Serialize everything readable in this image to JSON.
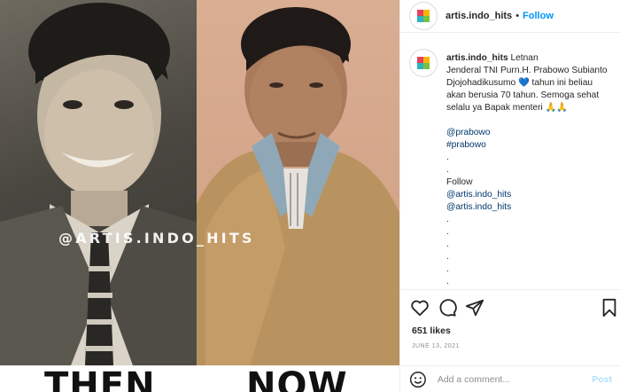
{
  "photo": {
    "watermark": "@ARTIS.INDO_HITS",
    "label_then": "THEN",
    "label_now": "NOW"
  },
  "post": {
    "username": "artis.indo_hits",
    "header_separator": "•",
    "follow_label": "Follow",
    "caption": {
      "username": "artis.indo_hits",
      "text_lines": [
        " Letnan",
        "Jenderal TNI Purn.H. Prabowo Subianto",
        "Djojohadikusumo 💙 tahun ini beliau",
        "akan berusia 70 tahun. Semoga sehat",
        "selalu ya Bapak menteri 🙏🙏"
      ],
      "mention_1": "@prabowo",
      "hashtag_1": "#prabowo",
      "dot": ".",
      "follow_word": "Follow",
      "mention_2": "@artis.indo_hits",
      "mention_3": "@artis.indo_hits"
    },
    "likes": "651 likes",
    "date": "JUNE 13, 2021",
    "comment_placeholder": "Add a comment...",
    "post_label": "Post",
    "icons": [
      "heart-icon",
      "comment-icon",
      "share-icon",
      "bookmark-icon",
      "emoji-icon"
    ],
    "colors": {
      "follow": "#0095f6",
      "link": "#00376b",
      "post_disabled": "#b2dffc",
      "heart_emoji": "#4fc3f7"
    }
  }
}
